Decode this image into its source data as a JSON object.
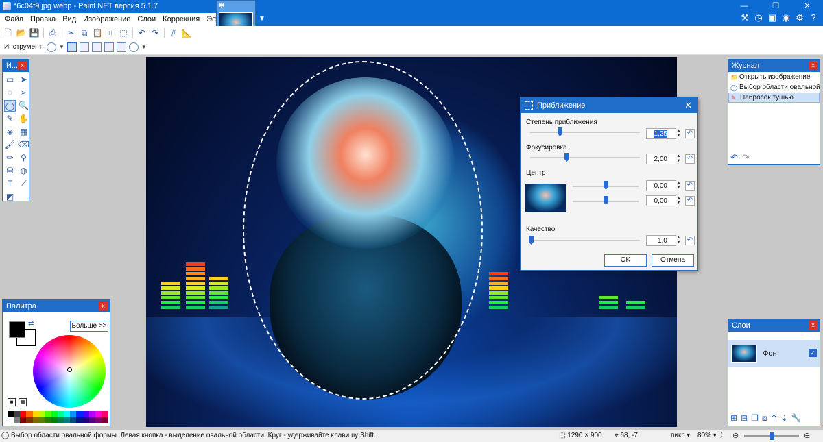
{
  "window": {
    "title": "*6c04f9.jpg.webp - Paint.NET версия 5.1.7",
    "minimize": "—",
    "maximize": "❐",
    "close": "✕"
  },
  "menu": [
    "Файл",
    "Правка",
    "Вид",
    "Изображение",
    "Слои",
    "Коррекция",
    "Эффекты"
  ],
  "toolbar2": {
    "tool_label": "Инструмент:"
  },
  "tools_panel": {
    "title": "И...",
    "close": "x"
  },
  "palette_panel": {
    "title": "Палитра",
    "close": "x",
    "more_button": "Больше >>",
    "swatch_colors": [
      "#000000",
      "#404040",
      "#ff0000",
      "#ff6a00",
      "#ffd800",
      "#b6ff00",
      "#4cff00",
      "#00ff21",
      "#00ff90",
      "#00ffff",
      "#0094ff",
      "#0026ff",
      "#4800ff",
      "#b200ff",
      "#ff00dc",
      "#ff006e",
      "#ffffff",
      "#808080",
      "#7f0000",
      "#7f3300",
      "#7f6a00",
      "#5b7f00",
      "#267f00",
      "#007f0e",
      "#007f46",
      "#007f7f",
      "#004a7f",
      "#00137f",
      "#21007f",
      "#57007f",
      "#7f006e",
      "#7f0037"
    ]
  },
  "history_panel": {
    "title": "Журнал",
    "close": "x",
    "items": [
      {
        "label": "Открыть изображение",
        "icon": "folder-icon"
      },
      {
        "label": "Выбор области овальной формы",
        "icon": "ellipse-select-icon"
      },
      {
        "label": "Набросок тушью",
        "icon": "ink-sketch-icon"
      }
    ]
  },
  "layers_panel": {
    "title": "Слои",
    "close": "x",
    "layer_name": "Фон"
  },
  "zoom_dialog": {
    "title": "Приближение",
    "close": "✕",
    "zoom_label": "Степень приближения",
    "zoom_value": "1,25",
    "focus_label": "Фокусировка",
    "focus_value": "2,00",
    "center_label": "Центр",
    "center_x": "0,00",
    "center_y": "0,00",
    "quality_label": "Качество",
    "quality_value": "1,0",
    "ok": "OK",
    "cancel": "Отмена"
  },
  "statusbar": {
    "hint": "Выбор области овальной формы. Левая кнопка - выделение овальной области. Круг - удерживайте клавишу Shift.",
    "image_size": "1290 × 900",
    "cursor_pos": "68, -7",
    "units": "пикс",
    "zoom": "80%"
  }
}
